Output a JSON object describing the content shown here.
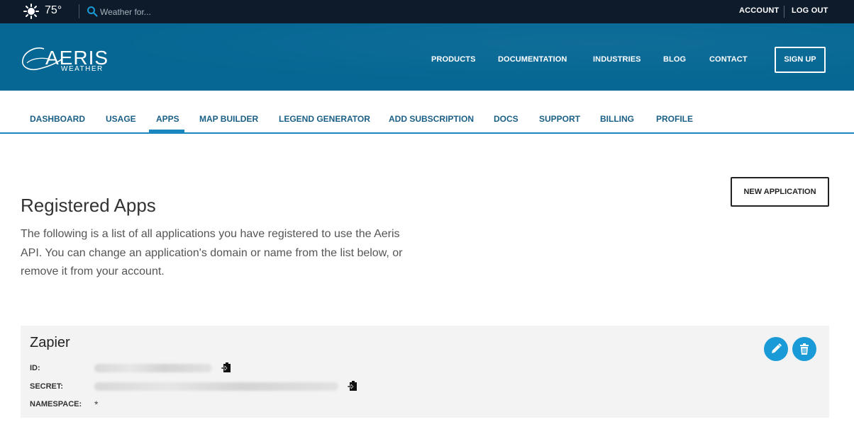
{
  "topbar": {
    "temperature": "75°",
    "weather_icon": "sun-icon",
    "search_placeholder": "Weather for...",
    "account_label": "ACCOUNT",
    "logout_label": "LOG OUT"
  },
  "header": {
    "logo_main": "AERIS",
    "logo_sub": "WEATHER",
    "nav": [
      "PRODUCTS",
      "DOCUMENTATION",
      "INDUSTRIES",
      "BLOG",
      "CONTACT"
    ],
    "signup_label": "SIGN UP"
  },
  "subnav": {
    "items": [
      "DASHBOARD",
      "USAGE",
      "APPS",
      "MAP BUILDER",
      "LEGEND GENERATOR",
      "ADD SUBSCRIPTION",
      "DOCS",
      "SUPPORT",
      "BILLING",
      "PROFILE"
    ],
    "active": "APPS"
  },
  "content": {
    "title": "Registered Apps",
    "intro": "The following is a list of all applications you have registered to use the Aeris API. You can change an application's domain or name from the list below, or remove it from your account.",
    "new_app_label": "NEW APPLICATION"
  },
  "app": {
    "name": "Zapier",
    "id_label": "ID:",
    "secret_label": "SECRET:",
    "namespace_label": "NAMESPACE:",
    "namespace_value": "*",
    "edit_icon": "pencil-icon",
    "delete_icon": "trash-icon",
    "copy_icon": "clipboard-copy-icon"
  },
  "colors": {
    "topbar_bg": "#0d1b2a",
    "header_bg": "#066794",
    "accent": "#1a87c0",
    "action_button": "#1a9ad6",
    "card_bg": "#f3f3f3"
  }
}
